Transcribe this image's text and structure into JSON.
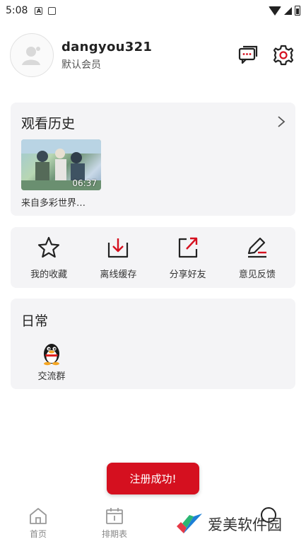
{
  "status_bar": {
    "time": "5:08"
  },
  "profile": {
    "username": "dangyou321",
    "member_level": "默认会员"
  },
  "history": {
    "title": "观看历史",
    "items": [
      {
        "title": "来自多彩世界…",
        "duration": "06:37"
      }
    ]
  },
  "quick_actions": [
    {
      "label": "我的收藏",
      "icon": "star-icon"
    },
    {
      "label": "离线缓存",
      "icon": "download-icon"
    },
    {
      "label": "分享好友",
      "icon": "share-icon"
    },
    {
      "label": "意见反馈",
      "icon": "feedback-icon"
    }
  ],
  "daily": {
    "title": "日常",
    "items": [
      {
        "label": "交流群",
        "icon": "qq-penguin-icon"
      }
    ]
  },
  "toast": {
    "text": "注册成功!"
  },
  "tab_bar": {
    "tabs": [
      {
        "label": "首页",
        "icon": "home-icon"
      },
      {
        "label": "排期表",
        "icon": "calendar-icon"
      }
    ]
  },
  "watermark": {
    "text": "爱美软件园"
  },
  "colors": {
    "accent": "#d5101f",
    "card_bg": "#f4f4f6"
  }
}
